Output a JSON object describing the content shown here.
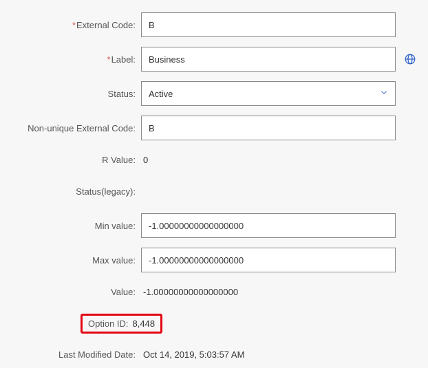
{
  "form": {
    "external_code": {
      "label": "External Code:",
      "value": "B",
      "required": true
    },
    "label_field": {
      "label": "Label:",
      "value": "Business",
      "required": true
    },
    "status": {
      "label": "Status:",
      "value": "Active"
    },
    "non_unique_external_code": {
      "label": "Non-unique External Code:",
      "value": "B"
    },
    "r_value": {
      "label": "R Value:",
      "value": "0"
    },
    "status_legacy": {
      "label": "Status(legacy):",
      "value": ""
    },
    "min_value": {
      "label": "Min value:",
      "value": "-1.00000000000000000"
    },
    "max_value": {
      "label": "Max value:",
      "value": "-1.00000000000000000"
    },
    "value": {
      "label": "Value:",
      "value": "-1.00000000000000000"
    },
    "option_id": {
      "label": "Option ID:",
      "value": "8,448"
    },
    "last_modified": {
      "label": "Last Modified Date:",
      "value": "Oct 14, 2019, 5:03:57 AM"
    }
  }
}
